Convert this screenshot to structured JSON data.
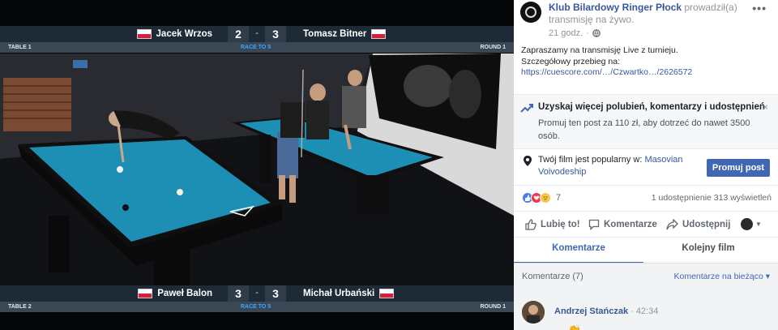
{
  "video": {
    "top_match": {
      "player_left": "Jacek Wrzos",
      "score_left": "2",
      "separator": "-",
      "score_right": "3",
      "player_right": "Tomasz Bitner",
      "table_label": "TABLE 1",
      "race_label": "RACE TO 5",
      "round_label": "ROUND 1"
    },
    "bottom_match": {
      "player_left": "Paweł Balon",
      "score_left": "3",
      "separator": "-",
      "score_right": "3",
      "player_right": "Michał Urbański",
      "table_label": "TABLE 2",
      "race_label": "RACE TO 5",
      "round_label": "ROUND 1"
    }
  },
  "post": {
    "page_name": "Klub Bilardowy Ringer Płock",
    "action_text": "prowadził(a) transmisję na żywo.",
    "time": "21 godz.",
    "more_label": "•••",
    "body_line1": "Zapraszamy na transmisję Live z turnieju.",
    "body_line2": "Szczegółowy przebieg na:",
    "link": "https://cuescore.com/…/Czwartko…/2626572"
  },
  "promo": {
    "title": "Uzyskaj więcej polubień, komentarzy i udostępnień",
    "description": "Promuj ten post za 110 zł, aby dotrzeć do nawet 3500 osób.",
    "close_label": "×"
  },
  "popular": {
    "text": "Twój film jest popularny w:",
    "location": "Masovian Voivodeship",
    "button_label": "Promuj post"
  },
  "stats": {
    "reactions_count": "7",
    "shares_views": "1 udostępnienie  313 wyświetleń"
  },
  "actions": {
    "like": "Lubię to!",
    "comment": "Komentarze",
    "share": "Udostępnij"
  },
  "tabs": {
    "comments": "Komentarze",
    "next_video": "Kolejny film"
  },
  "comments": {
    "count_label": "Komentarze (7)",
    "sort_label": "Komentarze na bieżąco ▾",
    "first": {
      "author": "Andrzej Stańczak",
      "time": "· 42:34"
    }
  },
  "colors": {
    "facebook_blue": "#4267b2",
    "link_blue": "#365899",
    "scorebar": "#1e2a36",
    "table_felt": "#1e8fb4"
  }
}
